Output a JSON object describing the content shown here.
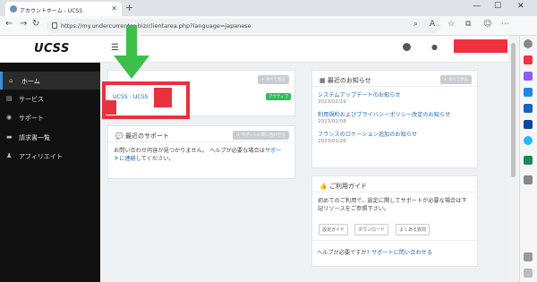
{
  "browser": {
    "tab_title": "アカウントホーム - UCSS",
    "url": "https://my.undercurrentss.biz/clientarea.php?language=japanese",
    "new_tab": "+",
    "close": "✕"
  },
  "header": {
    "logo": "UCSS",
    "menu_icon": "☰"
  },
  "sidebar": {
    "items": [
      {
        "icon": "home-icon",
        "glyph": "🏠",
        "label": "ホーム"
      },
      {
        "icon": "server-icon",
        "glyph": "▤",
        "label": "サービス"
      },
      {
        "icon": "support-icon",
        "glyph": "◉",
        "label": "サポート"
      },
      {
        "icon": "billing-icon",
        "glyph": "▬",
        "label": "請求書一覧"
      },
      {
        "icon": "affiliate-icon",
        "glyph": "👥",
        "label": "アフィリエイト"
      }
    ]
  },
  "services_card": {
    "view_all": "+ すべて見る",
    "service_name": "UCSS - UCSS",
    "status": "アクティブ"
  },
  "support_card": {
    "title": "最近のサポート",
    "open_ticket": "+ サポートに問い合わせる",
    "empty_text_1": "お問い合わせ内容が見つかりません。 ヘルプが必要な場合は",
    "empty_link": "サポー",
    "empty_text_2": "ト",
    "empty_link_2": "に連絡",
    "empty_text_3": "してください。"
  },
  "news_card": {
    "title": "最近のお知らせ",
    "view_all": "+ すべて見る",
    "items": [
      {
        "title": "システムアップデートのお知らせ",
        "date": "2023/02/19"
      },
      {
        "title": "利用規約およびプライバシーポリシー改定のお知らせ",
        "date": "2023/02/08"
      },
      {
        "title": "フランスのロケーション追加のお知らせ",
        "date": "2023/01/26"
      }
    ]
  },
  "guide_card": {
    "title": "ご利用ガイド",
    "text": "初めてのご利用で、設定に関してサポートが必要な場合は下記リソースをご参照下さい。",
    "buttons": [
      "設定ガイド",
      "ダウンロード",
      "よくある質問"
    ],
    "help_text": "ヘルプが必要ですか?",
    "help_link": "サポートに問い合わせる"
  },
  "colors": {
    "accent": "#3a8fd8",
    "highlight": "#e8313f",
    "arrow": "#3cc04a",
    "active": "#2ebd59"
  }
}
